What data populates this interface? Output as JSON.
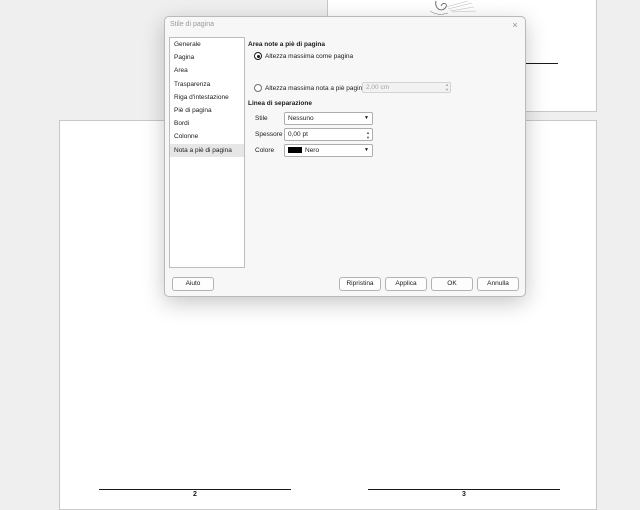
{
  "dialog": {
    "title": "Stile di pagina",
    "close_icon": "×"
  },
  "sidebar": {
    "items": [
      {
        "label": "Generale"
      },
      {
        "label": "Pagina"
      },
      {
        "label": "Area"
      },
      {
        "label": "Trasparenza"
      },
      {
        "label": "Riga d'intestazione"
      },
      {
        "label": "Piè di pagina"
      },
      {
        "label": "Bordi"
      },
      {
        "label": "Colonne"
      },
      {
        "label": "Nota a piè di pagina"
      }
    ],
    "selected": "Nota a piè di pagina"
  },
  "footnote_area": {
    "heading": "Area note a piè di pagina",
    "option_page_height": "Altezza massima come pagina",
    "option_max_height": "Altezza massima nota a piè pagina",
    "max_height_value": "2,00 cm"
  },
  "separator_line": {
    "heading": "Linea di separazione",
    "style_label": "Stile",
    "style_value": "Nessuno",
    "thickness_label": "Spessore",
    "thickness_value": "0,00 pt",
    "color_label": "Colore",
    "color_value": "Nero",
    "color_hex": "#000000"
  },
  "buttons": {
    "help": "Aiuto",
    "reset": "Ripristina",
    "apply": "Applica",
    "ok": "OK",
    "cancel": "Annulla"
  },
  "document": {
    "page_numbers": [
      "2",
      "3"
    ]
  }
}
